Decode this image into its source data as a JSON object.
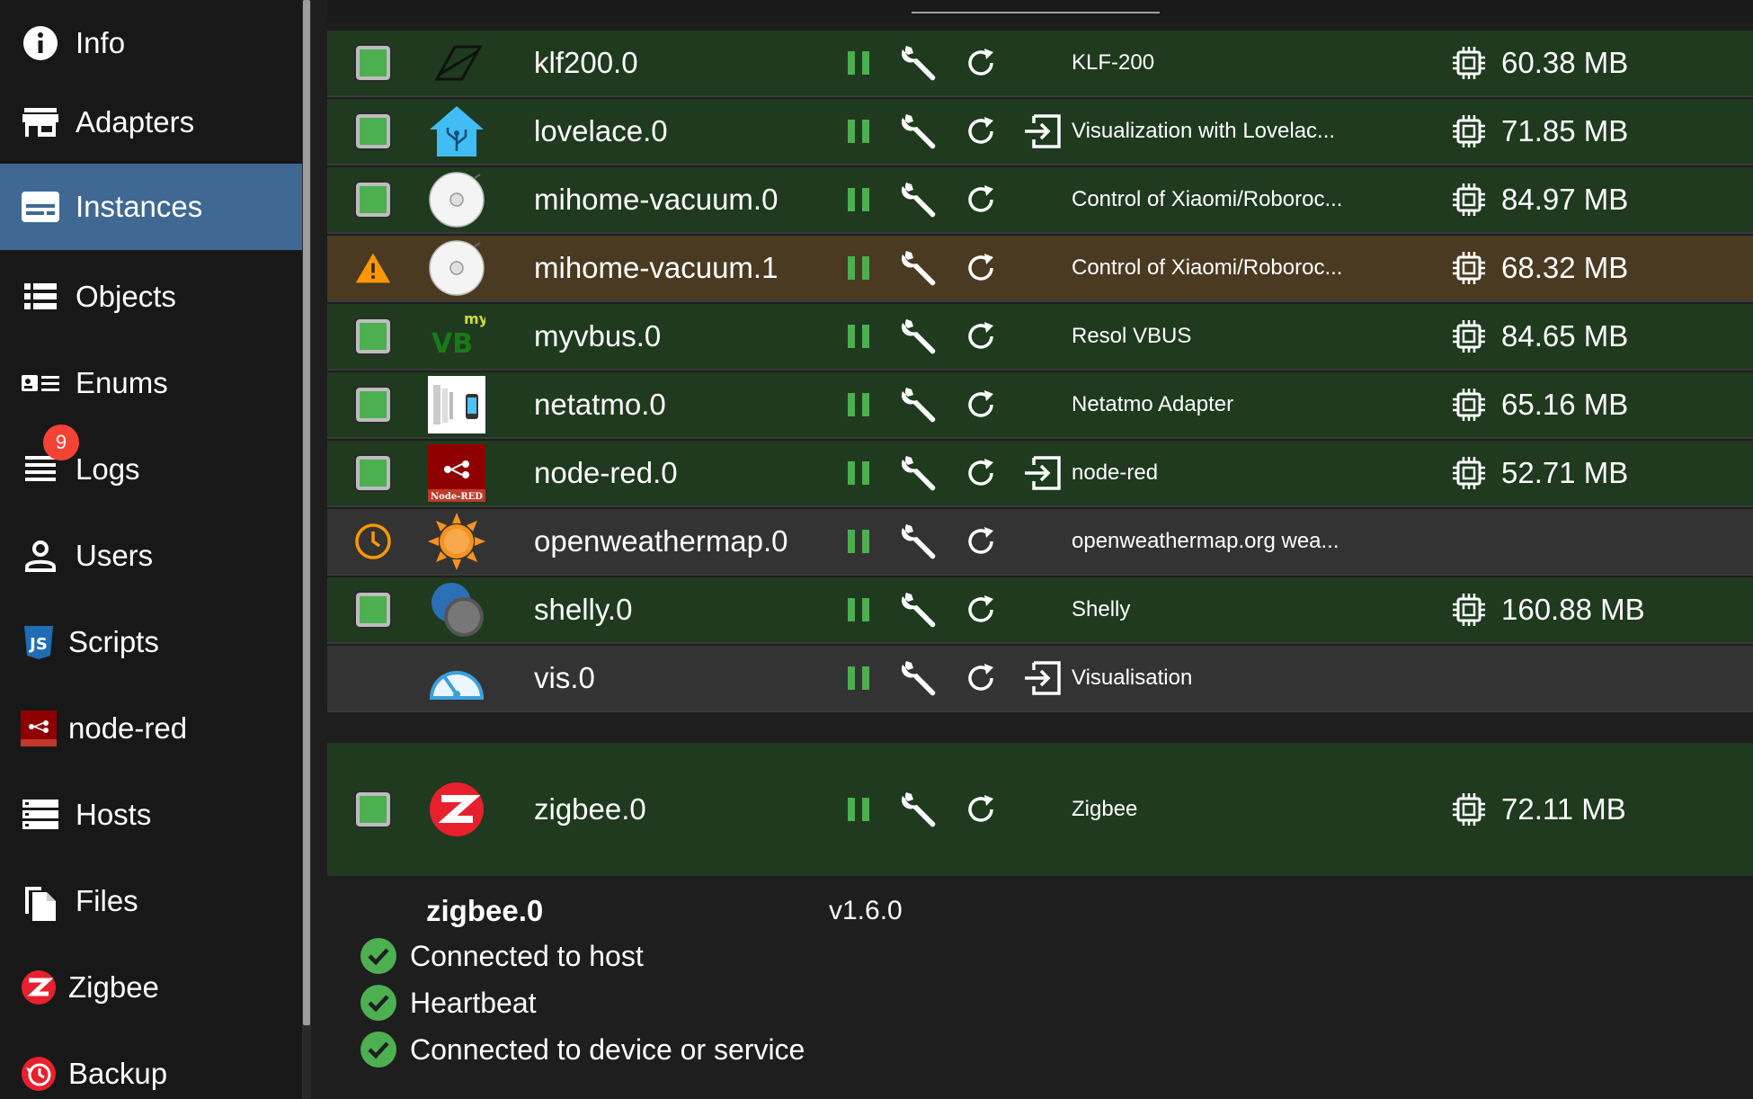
{
  "sidebar": {
    "items": [
      {
        "label": "Info",
        "icon": "info-icon"
      },
      {
        "label": "Adapters",
        "icon": "store-icon"
      },
      {
        "label": "Instances",
        "icon": "instances-icon",
        "active": true
      },
      {
        "label": "Objects",
        "icon": "list-icon"
      },
      {
        "label": "Enums",
        "icon": "enums-icon"
      },
      {
        "label": "Logs",
        "icon": "logs-icon",
        "badge": "9"
      },
      {
        "label": "Users",
        "icon": "user-icon"
      },
      {
        "label": "Scripts",
        "icon": "javascript-icon"
      },
      {
        "label": "node-red",
        "icon": "node-red-icon"
      },
      {
        "label": "Hosts",
        "icon": "hosts-icon"
      },
      {
        "label": "Files",
        "icon": "files-icon"
      },
      {
        "label": "Zigbee",
        "icon": "zigbee-icon"
      },
      {
        "label": "Backup",
        "icon": "backup-icon"
      }
    ]
  },
  "instances": [
    {
      "name": "klf200.0",
      "status": "ok",
      "logo": "klf200-logo",
      "open_link": false,
      "description": "KLF-200",
      "memory": "60.38 MB"
    },
    {
      "name": "lovelace.0",
      "status": "ok",
      "logo": "lovelace-logo",
      "open_link": true,
      "description": "Visualization with Lovelac...",
      "memory": "71.85 MB"
    },
    {
      "name": "mihome-vacuum.0",
      "status": "ok",
      "logo": "vacuum-logo",
      "open_link": false,
      "description": "Control of Xiaomi/Roboroc...",
      "memory": "84.97 MB"
    },
    {
      "name": "mihome-vacuum.1",
      "status": "warning",
      "logo": "vacuum-logo",
      "open_link": false,
      "description": "Control of Xiaomi/Roboroc...",
      "memory": "68.32 MB"
    },
    {
      "name": "myvbus.0",
      "status": "ok",
      "logo": "myvbus-logo",
      "open_link": false,
      "description": "Resol VBUS",
      "memory": "84.65 MB"
    },
    {
      "name": "netatmo.0",
      "status": "ok",
      "logo": "netatmo-logo",
      "open_link": false,
      "description": "Netatmo Adapter",
      "memory": "65.16 MB"
    },
    {
      "name": "node-red.0",
      "status": "ok",
      "logo": "node-red-logo",
      "open_link": true,
      "description": "node-red",
      "memory": "52.71 MB"
    },
    {
      "name": "openweathermap.0",
      "status": "scheduled",
      "logo": "openweathermap-logo",
      "open_link": false,
      "description": "openweathermap.org wea...",
      "memory": ""
    },
    {
      "name": "shelly.0",
      "status": "ok",
      "logo": "shelly-logo",
      "open_link": false,
      "description": "Shelly",
      "memory": "160.88 MB"
    },
    {
      "name": "vis.0",
      "status": "none",
      "logo": "vis-logo",
      "open_link": true,
      "description": "Visualisation",
      "memory": ""
    }
  ],
  "expanded": {
    "name": "zigbee.0",
    "description": "Zigbee",
    "memory": "72.11 MB",
    "title": "zigbee.0",
    "version": "v1.6.0",
    "checks": [
      "Connected to host",
      "Heartbeat",
      "Connected to device or service"
    ]
  },
  "colors": {
    "row_ok": "#1f3a1f",
    "row_warning": "#4a3a22",
    "row_neutral": "#333333",
    "status_green": "#4caf50",
    "sidebar_active": "#3f6993",
    "warning_orange": "#ff9800",
    "badge_red": "#f44336"
  }
}
